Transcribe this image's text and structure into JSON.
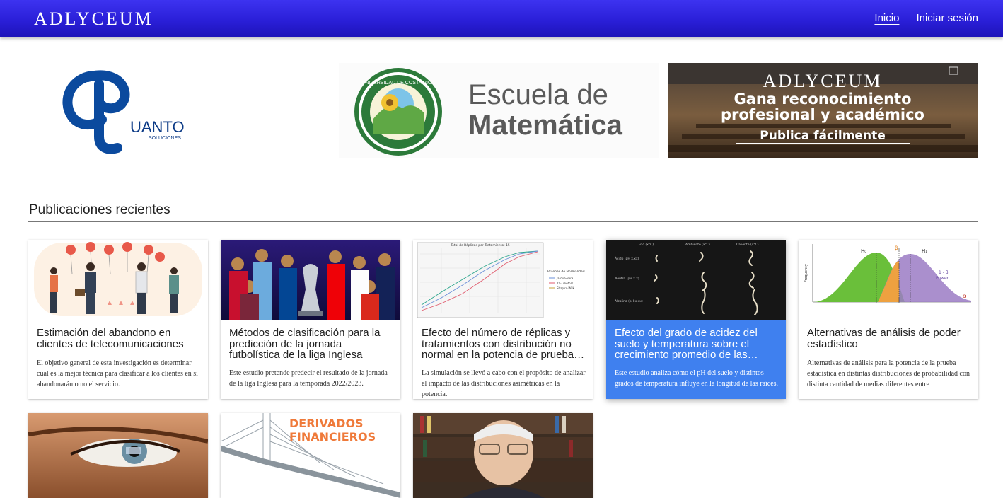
{
  "header": {
    "brand": "ADLYCEUM",
    "nav": [
      {
        "label": "Inicio",
        "active": true
      },
      {
        "label": "Iniciar sesión",
        "active": false
      }
    ]
  },
  "banners": {
    "cuanto": {
      "logo_text": "UANTO",
      "sub_text": "SOLUCIONES"
    },
    "escuela": {
      "line1": "Escuela de",
      "line2": "Matemática",
      "seal_text": "UNIVERSIDAD DE COSTA RICA"
    },
    "adlyceum": {
      "brand": "ADLYCEUM",
      "line1": "Gana reconocimiento",
      "line2": "profesional y académico",
      "line3": "Publica fácilmente"
    }
  },
  "section": {
    "title": "Publicaciones recientes"
  },
  "cards": [
    {
      "title": "Estimación del abandono en clientes de telecomunicaciones",
      "description": "El objetivo general de esta investigación es determinar cuál es la mejor técnica para clasificar a los clientes en si abandonarán o no el servicio.",
      "image": "customer-churn-illustration"
    },
    {
      "title": "Métodos de clasificación para la predicción de la jornada futbolística de la liga Inglesa",
      "description": "Este estudio pretende predecir el resultado de la jornada de la liga Inglesa para la temporada 2022/2023.",
      "image": "premier-league-players-photo"
    },
    {
      "title": "Efecto del número de réplicas y tratamientos con distribución no normal en la potencia de pruebas de normalidad",
      "description": "La simulación se llevó a cabo con el propósito de analizar el impacto de las distribuciones asimétricas en la potencia.",
      "image": "replicas-line-chart",
      "chart_title": "Total de Réplicas por Tratamiento: 15",
      "legend_title": "Pruebas de Normalidad",
      "legend": [
        "Jarque-Bera",
        "KS-Lilliefors",
        "Shapiro-Wilk"
      ]
    },
    {
      "title": "Efecto del grado de acidez del suelo y temperatura sobre el crecimiento promedio de las plantas",
      "description": "Este estudio analiza cómo el pH del suelo y distintos grados de temperatura influye en la longitud de las raíces.",
      "image": "seedlings-grid-photo",
      "col_labels": [
        "Frío (x°C)",
        "Ambiente (x°C)",
        "Caliente (x°C)"
      ],
      "row_labels": [
        "Ácido (pH x.xx)",
        "Neutro (pH x.x)",
        "Alcalino (pH x.xx)"
      ]
    },
    {
      "title": "Alternativas de análisis de poder estadístico",
      "description": "Alternativas de análisis para la potencia de la prueba estadística en distintas distribuciones de probabilidad con distinta cantidad de medias diferentes entre",
      "image": "power-distribution-diagram",
      "labels": {
        "h0": "H₀",
        "h1": "H₁",
        "ylabel": "Frequency",
        "beta": "β",
        "power": "1 - β",
        "power_word": "Power",
        "alpha": "α"
      }
    },
    {
      "title": "",
      "description": "",
      "image": "eye-closeup-photo"
    },
    {
      "title": "",
      "description": "",
      "image": "derivados-financieros-bridge",
      "overlay": "DERIVADOS FINANCIEROS"
    },
    {
      "title": "",
      "description": "",
      "image": "elderly-man-bookshelf-photo"
    }
  ]
}
